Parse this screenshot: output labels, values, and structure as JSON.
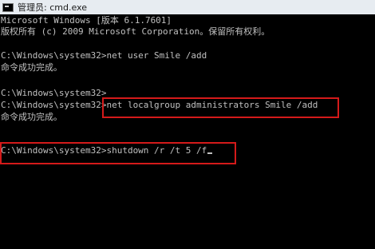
{
  "window": {
    "title": "管理员: cmd.exe",
    "icon": "cmd-icon"
  },
  "console": {
    "lines": [
      "Microsoft Windows [版本 6.1.7601]",
      "版权所有 (c) 2009 Microsoft Corporation。保留所有权利。",
      "",
      "C:\\Windows\\system32>net user Smile /add",
      "命令成功完成。",
      "",
      "C:\\Windows\\system32>",
      "C:\\Windows\\system32>net localgroup administrators Smile /add",
      "命令成功完成。",
      "",
      "",
      "C:\\Windows\\system32>shutdown /r /t 5 /f"
    ]
  },
  "highlights": {
    "color": "#d41a1a",
    "targets": [
      "net localgroup administrators Smile /add",
      "C:\\Windows\\system32>shutdown /r /t 5 /f"
    ]
  }
}
